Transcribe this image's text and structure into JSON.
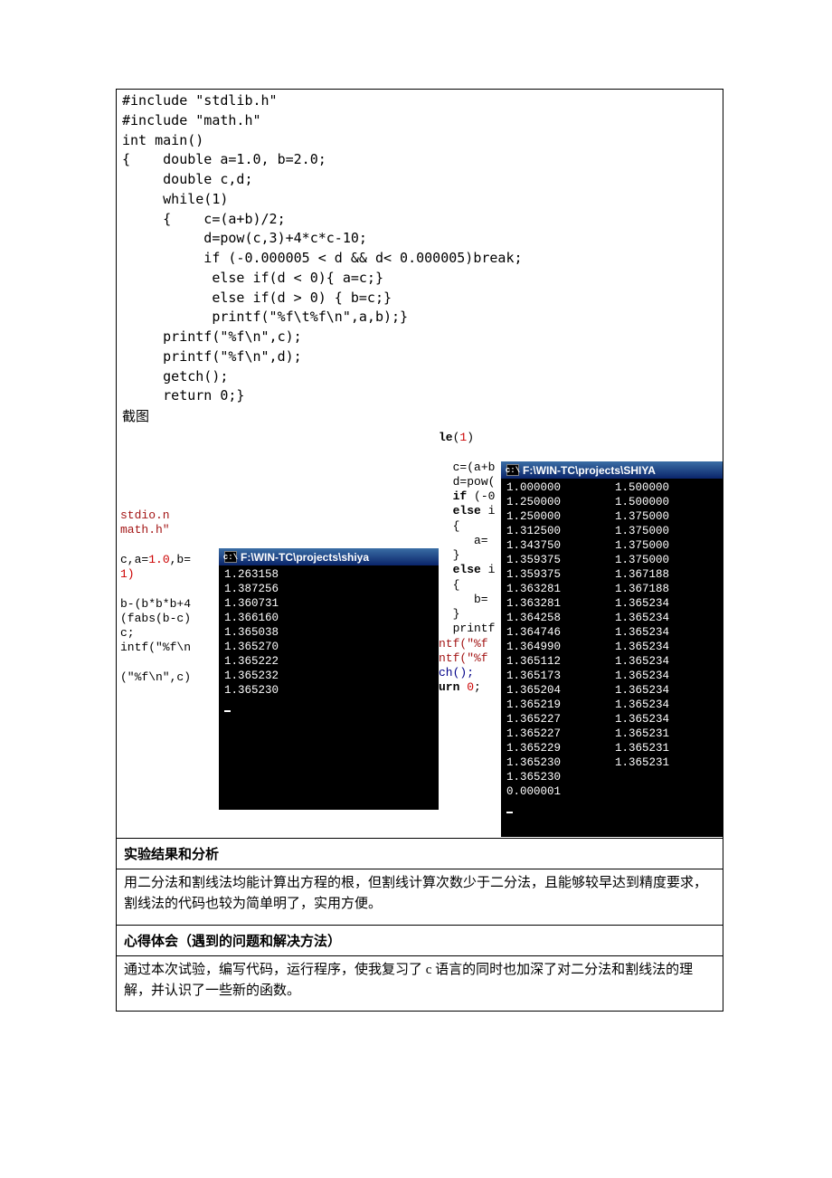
{
  "code": [
    "#include \"stdlib.h\"",
    "#include \"math.h\"",
    "int main()",
    "{    double a=1.0, b=2.0;",
    "     double c,d;",
    "     while(1)",
    "     {    c=(a+b)/2;",
    "          d=pow(c,3)+4*c*c-10;",
    "          if (-0.000005 < d && d< 0.000005)break;",
    "           else if(d < 0){ a=c;}",
    "           else if(d > 0) { b=c;}",
    "           printf(\"%f\\t%f\\n\",a,b);}",
    "     printf(\"%f\\n\",c);",
    "     printf(\"%f\\n\",d);",
    "     getch();",
    "     return 0;}"
  ],
  "screenshot_label": "截图",
  "ide_left": {
    "str1": "stdio.n",
    "str2": "math.h\"",
    "frag1": "c,a=",
    "num1": "1.0",
    "frag2": ",b=",
    "num2": "1)",
    "line3": "b-(b*b*b+4",
    "line4": "(fabs(b-c)",
    "line5": "c;",
    "line6": "intf(\"%f\\n",
    "line7": "(\"%f\\n\",c)"
  },
  "ide_right": {
    "l1": "le(1)",
    "l2": "c=(a+b",
    "l3": "d=pow(",
    "l4": "if (-0",
    "l5": "else i",
    "l6": "{",
    "l7": "   a=",
    "l8": "}",
    "l9": "else i",
    "l10": "{",
    "l11": "   b=",
    "l12": "}",
    "l13": "printf",
    "l14": "ntf(\"%f",
    "l15": "ntf(\"%f",
    "l16": "ch();",
    "l17": "urn 0;"
  },
  "console_left": {
    "title": "F:\\WIN-TC\\projects\\shiya",
    "lines": [
      "1.263158",
      "1.387256",
      "1.360731",
      "1.366160",
      "1.365038",
      "1.365270",
      "1.365222",
      "1.365232",
      "1.365230"
    ]
  },
  "console_right": {
    "title": "F:\\WIN-TC\\projects\\SHIYA",
    "rows": [
      [
        "1.000000",
        "1.500000"
      ],
      [
        "1.250000",
        "1.500000"
      ],
      [
        "1.250000",
        "1.375000"
      ],
      [
        "1.312500",
        "1.375000"
      ],
      [
        "1.343750",
        "1.375000"
      ],
      [
        "1.359375",
        "1.375000"
      ],
      [
        "1.359375",
        "1.367188"
      ],
      [
        "1.363281",
        "1.367188"
      ],
      [
        "1.363281",
        "1.365234"
      ],
      [
        "1.364258",
        "1.365234"
      ],
      [
        "1.364746",
        "1.365234"
      ],
      [
        "1.364990",
        "1.365234"
      ],
      [
        "1.365112",
        "1.365234"
      ],
      [
        "1.365173",
        "1.365234"
      ],
      [
        "1.365204",
        "1.365234"
      ],
      [
        "1.365219",
        "1.365234"
      ],
      [
        "1.365227",
        "1.365234"
      ],
      [
        "1.365227",
        "1.365231"
      ],
      [
        "1.365229",
        "1.365231"
      ],
      [
        "1.365230",
        "1.365231"
      ],
      [
        "1.365230",
        ""
      ],
      [
        "0.000001",
        ""
      ]
    ]
  },
  "sec1_head": "实验结果和分析",
  "sec1_body": "用二分法和割线法均能计算出方程的根，但割线计算次数少于二分法，且能够较早达到精度要求，割线法的代码也较为简单明了，实用方便。",
  "sec2_head": "心得体会（遇到的问题和解决方法）",
  "sec2_body": "通过本次试验，编写代码，运行程序，使我复习了 c 语言的同时也加深了对二分法和割线法的理解，并认识了一些新的函数。"
}
